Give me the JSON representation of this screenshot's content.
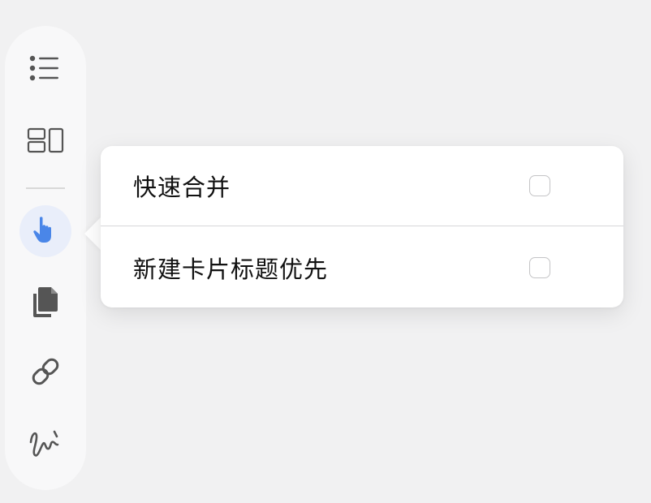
{
  "toolbar": {
    "items": [
      {
        "icon": "list-icon"
      },
      {
        "icon": "card-layout-icon"
      },
      {
        "icon": "pointer-hand-icon",
        "active": true
      },
      {
        "icon": "copy-documents-icon"
      },
      {
        "icon": "link-icon"
      },
      {
        "icon": "freehand-squiggle-icon"
      }
    ],
    "active_color": "#4a86e8",
    "icon_color": "#555555"
  },
  "popover": {
    "options": [
      {
        "label": "快速合并",
        "checked": false
      },
      {
        "label": "新建卡片标题优先",
        "checked": false
      }
    ]
  }
}
